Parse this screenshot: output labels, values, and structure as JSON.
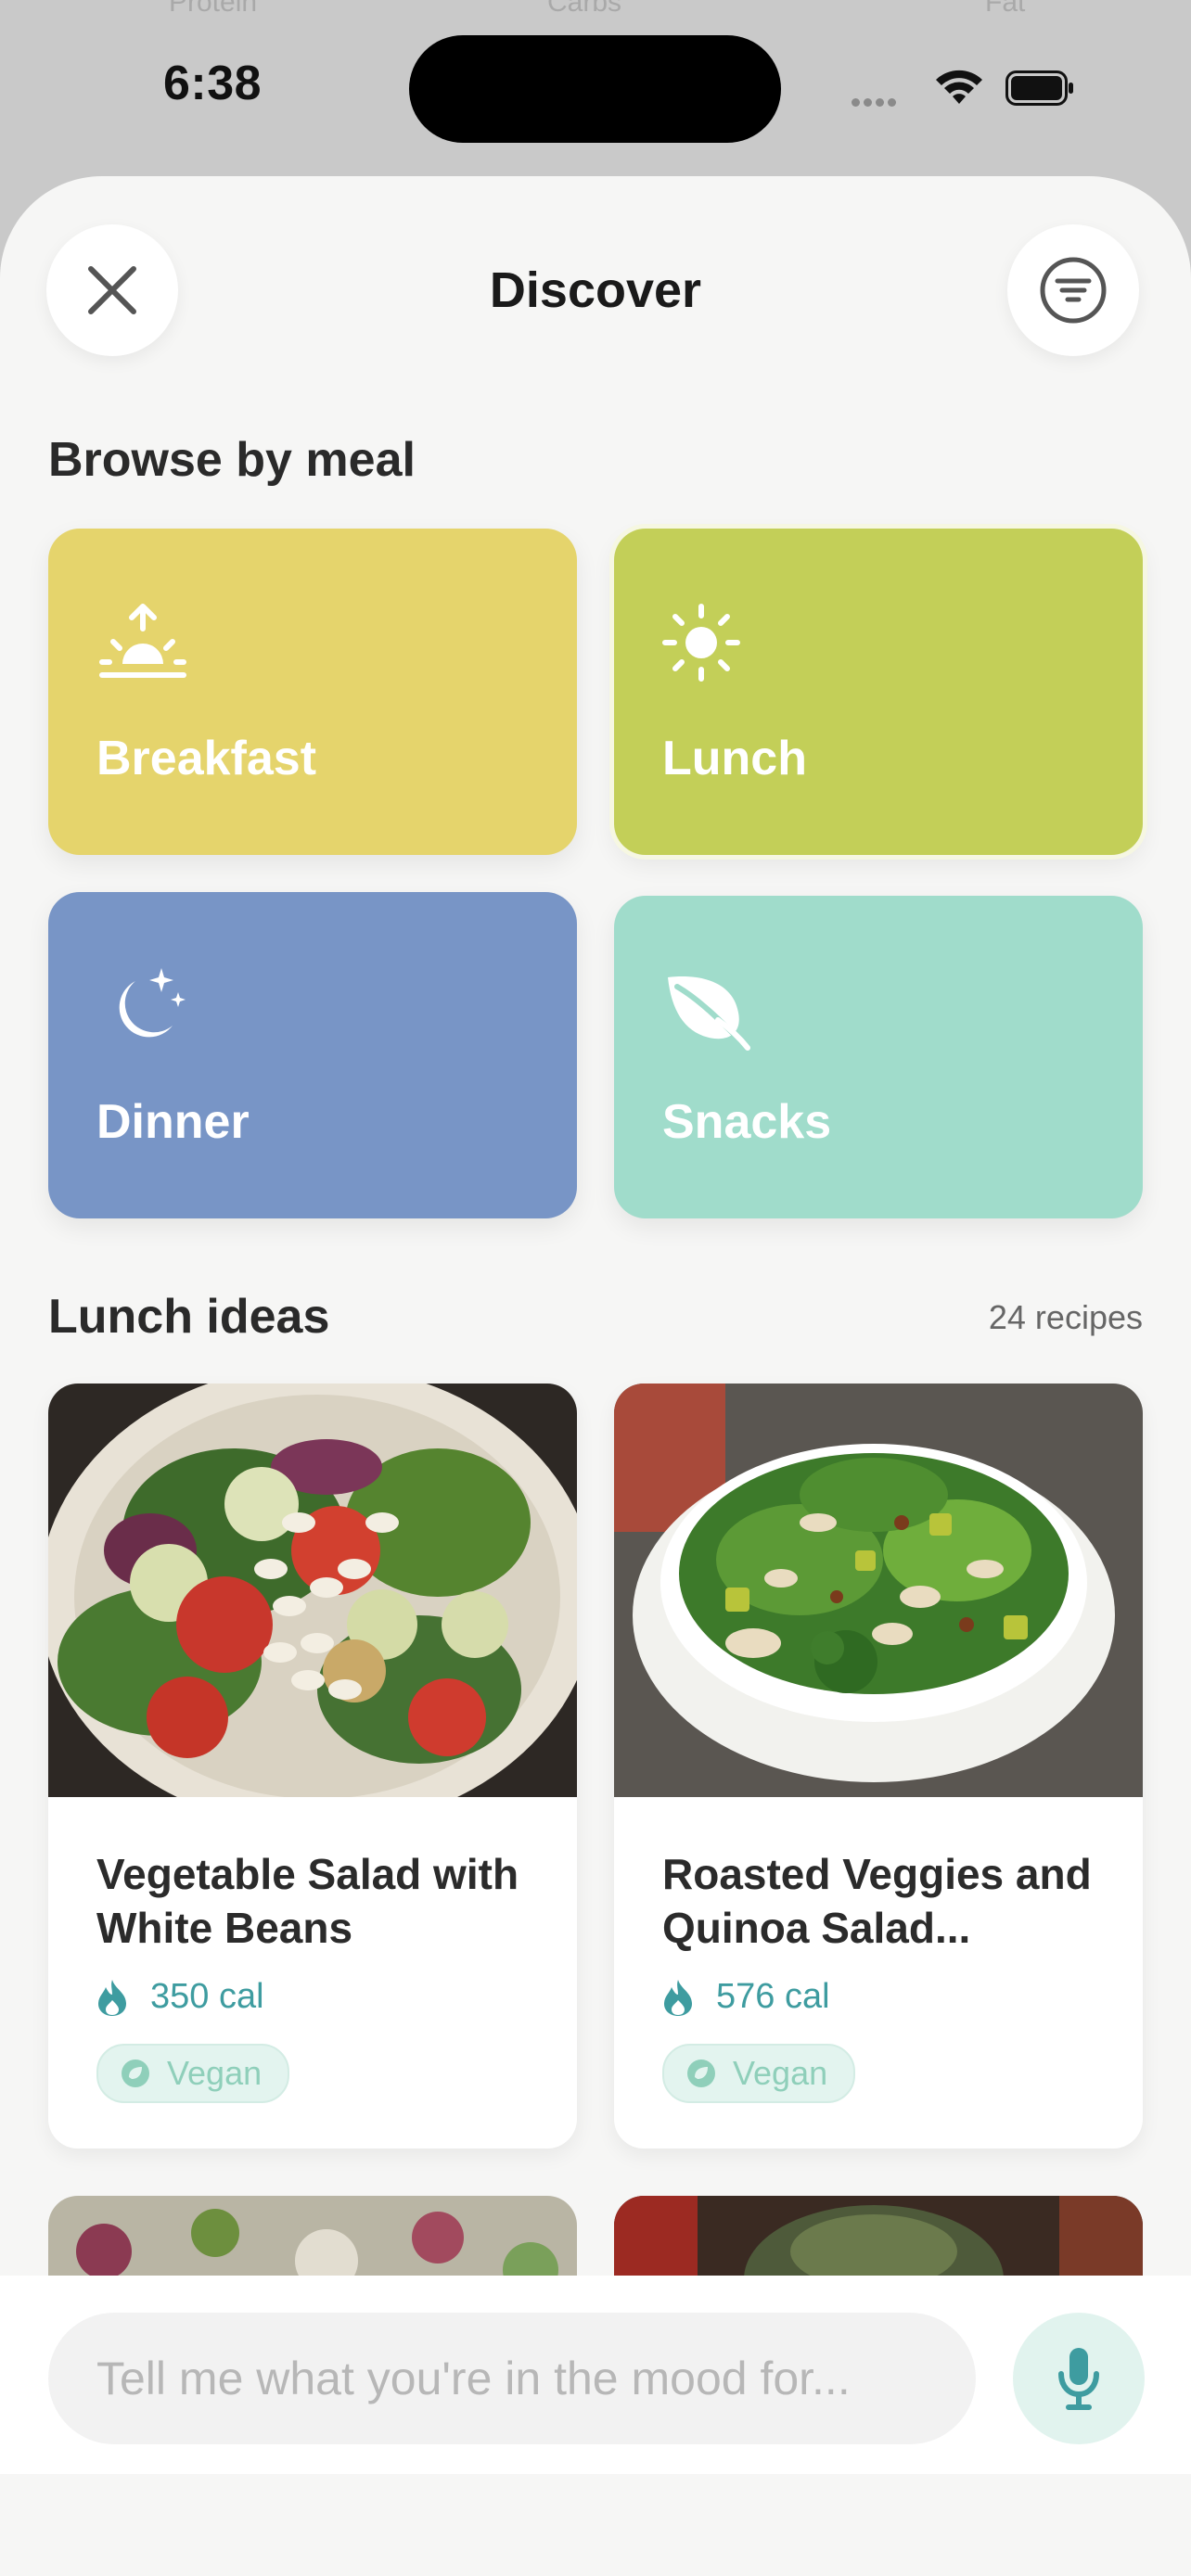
{
  "status": {
    "time": "6:38"
  },
  "background_labels": [
    "Protein",
    "Carbs",
    "Fat"
  ],
  "header": {
    "title": "Discover",
    "close_icon": "close-icon",
    "filter_icon": "filter-icon"
  },
  "browse": {
    "title": "Browse by meal",
    "meals": [
      {
        "label": "Breakfast",
        "icon": "sunrise-icon",
        "color": "#e5d46c",
        "selected": false
      },
      {
        "label": "Lunch",
        "icon": "sun-icon",
        "color": "#c3cf58",
        "selected": true
      },
      {
        "label": "Dinner",
        "icon": "moon-stars-icon",
        "color": "#7895c6",
        "selected": false
      },
      {
        "label": "Snacks",
        "icon": "leaf-icon",
        "color": "#a0dccb",
        "selected": false
      }
    ]
  },
  "ideas": {
    "title": "Lunch ideas",
    "count": "24 recipes",
    "recipes": [
      {
        "name": "Vegetable Salad with White Beans",
        "calories": "350 cal",
        "tag": "Vegan"
      },
      {
        "name": "Roasted Veggies and Quinoa Salad...",
        "calories": "576 cal",
        "tag": "Vegan"
      }
    ]
  },
  "composer": {
    "placeholder": "Tell me what you're in the mood for...",
    "mic_icon": "mic-icon"
  },
  "colors": {
    "accent": "#3e9ca0",
    "tag_bg": "#e3f4ef",
    "sheet_bg": "#f6f6f5"
  }
}
